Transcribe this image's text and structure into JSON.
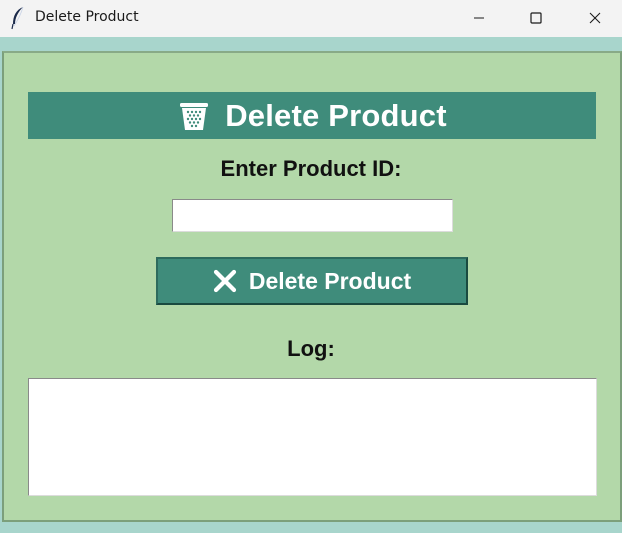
{
  "window": {
    "title": "Delete Product",
    "app_icon": "feather-icon",
    "controls": [
      "minimize-icon",
      "maximize-icon",
      "close-icon"
    ]
  },
  "header": {
    "icon": "trash-icon",
    "title": "Delete Product"
  },
  "form": {
    "product_id_label": "Enter Product ID:",
    "product_id_value": "",
    "delete_button_icon": "cross-icon",
    "delete_button_label": "Delete Product"
  },
  "log": {
    "label": "Log:",
    "content": ""
  },
  "colors": {
    "accent": "#3f8c7b",
    "panel_background": "#b3d8a9",
    "window_border": "#a8d5cc"
  }
}
